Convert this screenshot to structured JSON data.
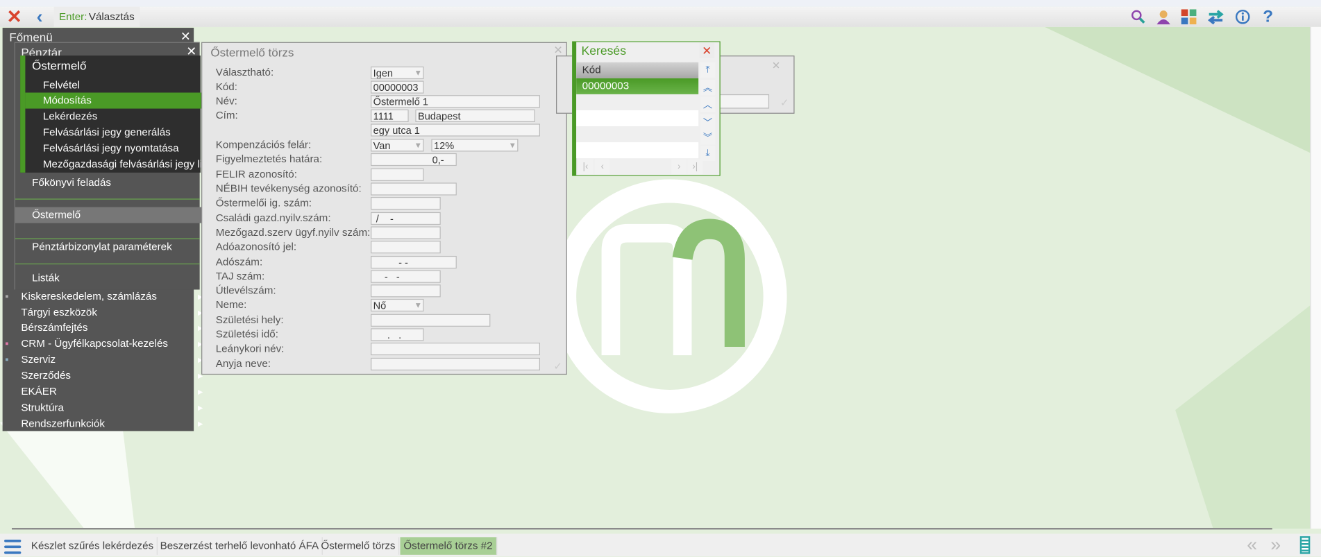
{
  "toolbar": {
    "enter_key": "Enter:",
    "enter_action": "Választás",
    "icons": [
      "close-icon",
      "back-icon",
      "search-icon",
      "user-icon",
      "apps-icon",
      "switch-icon",
      "info-icon",
      "help-icon"
    ]
  },
  "main_menu": {
    "title": "Főmenü",
    "items": [
      {
        "label": "Kiskereskedelem, számlázás"
      },
      {
        "label": "Tárgyi eszközök"
      },
      {
        "label": "Bérszámfejtés"
      },
      {
        "label": "CRM - Ügyfélkapcsolat-kezelés"
      },
      {
        "label": "Szerviz"
      },
      {
        "label": "Szerződés"
      },
      {
        "label": "EKÁER"
      },
      {
        "label": "Struktúra"
      },
      {
        "label": "Rendszerfunkciók"
      }
    ]
  },
  "cash_menu": {
    "title": "Pénztár",
    "items": [
      {
        "label": "Főkönyvi feladás"
      },
      {
        "label": "Őstermelő"
      },
      {
        "label": "Pénztárbizonylat paraméterek"
      },
      {
        "label": "Listák"
      }
    ]
  },
  "producer_menu": {
    "title": "Őstermelő",
    "items": [
      {
        "label": "Felvétel"
      },
      {
        "label": "Módosítás"
      },
      {
        "label": "Lekérdezés"
      },
      {
        "label": "Felvásárlási jegy generálás"
      },
      {
        "label": "Felvásárlási jegy nyomtatása"
      },
      {
        "label": "Mezőgazdasági felvásárlási jegy lista"
      }
    ]
  },
  "form": {
    "title": "Őstermelő törzs",
    "fields": {
      "selectable": {
        "label": "Választható:",
        "value": "Igen"
      },
      "code": {
        "label": "Kód:",
        "value": "00000003"
      },
      "name": {
        "label": "Név:",
        "value": "Őstermelő 1"
      },
      "address": {
        "label": "Cím:",
        "zip": "1111",
        "city": "Budapest",
        "street": "egy utca 1"
      },
      "surcharge": {
        "label": "Kompenzációs felár:",
        "value": "Van",
        "rate": "12%"
      },
      "warning_limit": {
        "label": "Figyelmeztetés határa:",
        "value": "0,-"
      },
      "felir": {
        "label": "FELIR azonosító:",
        "value": ""
      },
      "nebih": {
        "label": "NÉBIH tevékenység azonosító:",
        "value": ""
      },
      "producer_id": {
        "label": "Őstermelői ig. szám:",
        "value": ""
      },
      "family_farm": {
        "label": "Családi gazd.nyilv.szám:",
        "value": " /    -"
      },
      "agri_org": {
        "label": "Mezőgazd.szerv ügyf.nyilv szám:",
        "value": ""
      },
      "tax_id": {
        "label": "Adóazonosító jel:",
        "value": ""
      },
      "tax_number": {
        "label": "Adószám:",
        "value": "         - -"
      },
      "taj": {
        "label": "TAJ szám:",
        "value": "    -   -"
      },
      "passport": {
        "label": "Útlevélszám:",
        "value": ""
      },
      "gender": {
        "label": "Neme:",
        "value": "Nő"
      },
      "birth_place": {
        "label": "Születési hely:",
        "value": ""
      },
      "birth_date": {
        "label": "Születési idő:",
        "value": "     .   ."
      },
      "maiden_name": {
        "label": "Leánykori név:",
        "value": ""
      },
      "mother_name": {
        "label": "Anyja neve:",
        "value": ""
      }
    }
  },
  "search": {
    "title": "Keresés",
    "column": "Kód",
    "rows": [
      "00000003"
    ]
  },
  "taskbar": {
    "tabs": [
      "Készlet szűrés lekérdezés",
      "Beszerzést terhelő levonható ÁFA",
      "Őstermelő törzs",
      "Őstermelő törzs #2"
    ]
  },
  "colors": {
    "accent": "#4a9a26",
    "background": "#e3efdc",
    "menu": "#555555"
  }
}
